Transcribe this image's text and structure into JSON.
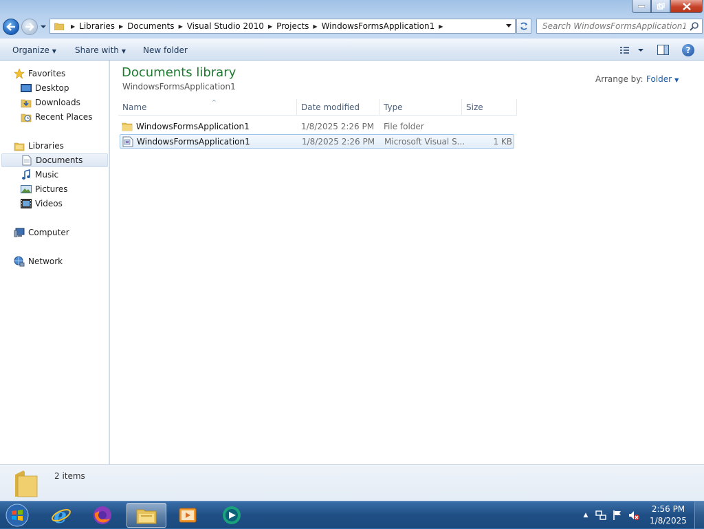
{
  "window": {
    "breadcrumb": [
      "Libraries",
      "Documents",
      "Visual Studio 2010",
      "Projects",
      "WindowsFormsApplication1"
    ],
    "search_placeholder": "Search WindowsFormsApplication1"
  },
  "toolbar": {
    "organize": "Organize",
    "share_with": "Share with",
    "new_folder": "New folder"
  },
  "sidebar": {
    "favorites": {
      "label": "Favorites",
      "items": [
        "Desktop",
        "Downloads",
        "Recent Places"
      ]
    },
    "libraries": {
      "label": "Libraries",
      "items": [
        "Documents",
        "Music",
        "Pictures",
        "Videos"
      ],
      "selected": "Documents"
    },
    "computer": "Computer",
    "network": "Network"
  },
  "content": {
    "title": "Documents library",
    "subtitle": "WindowsFormsApplication1",
    "arrange_by_label": "Arrange by:",
    "arrange_by_value": "Folder",
    "columns": {
      "name": "Name",
      "date": "Date modified",
      "type": "Type",
      "size": "Size"
    },
    "files": [
      {
        "name": "WindowsFormsApplication1",
        "date": "1/8/2025 2:26 PM",
        "type": "File folder",
        "size": "",
        "icon": "folder-icon"
      },
      {
        "name": "WindowsFormsApplication1",
        "date": "1/8/2025 2:26 PM",
        "type": "Microsoft Visual S...",
        "size": "1 KB",
        "icon": "solution-file-icon"
      }
    ]
  },
  "details": {
    "count": "2 items"
  },
  "taskbar": {
    "time": "2:56 PM",
    "date": "1/8/2025",
    "pinned": [
      "internet-explorer-icon",
      "firefox-icon",
      "windows-explorer-icon",
      "media-player-icon",
      "remote-app-icon"
    ]
  },
  "colors": {
    "accent": "#1e7a2f",
    "link": "#1c5aa6",
    "taskbar": "#1f4f85"
  }
}
